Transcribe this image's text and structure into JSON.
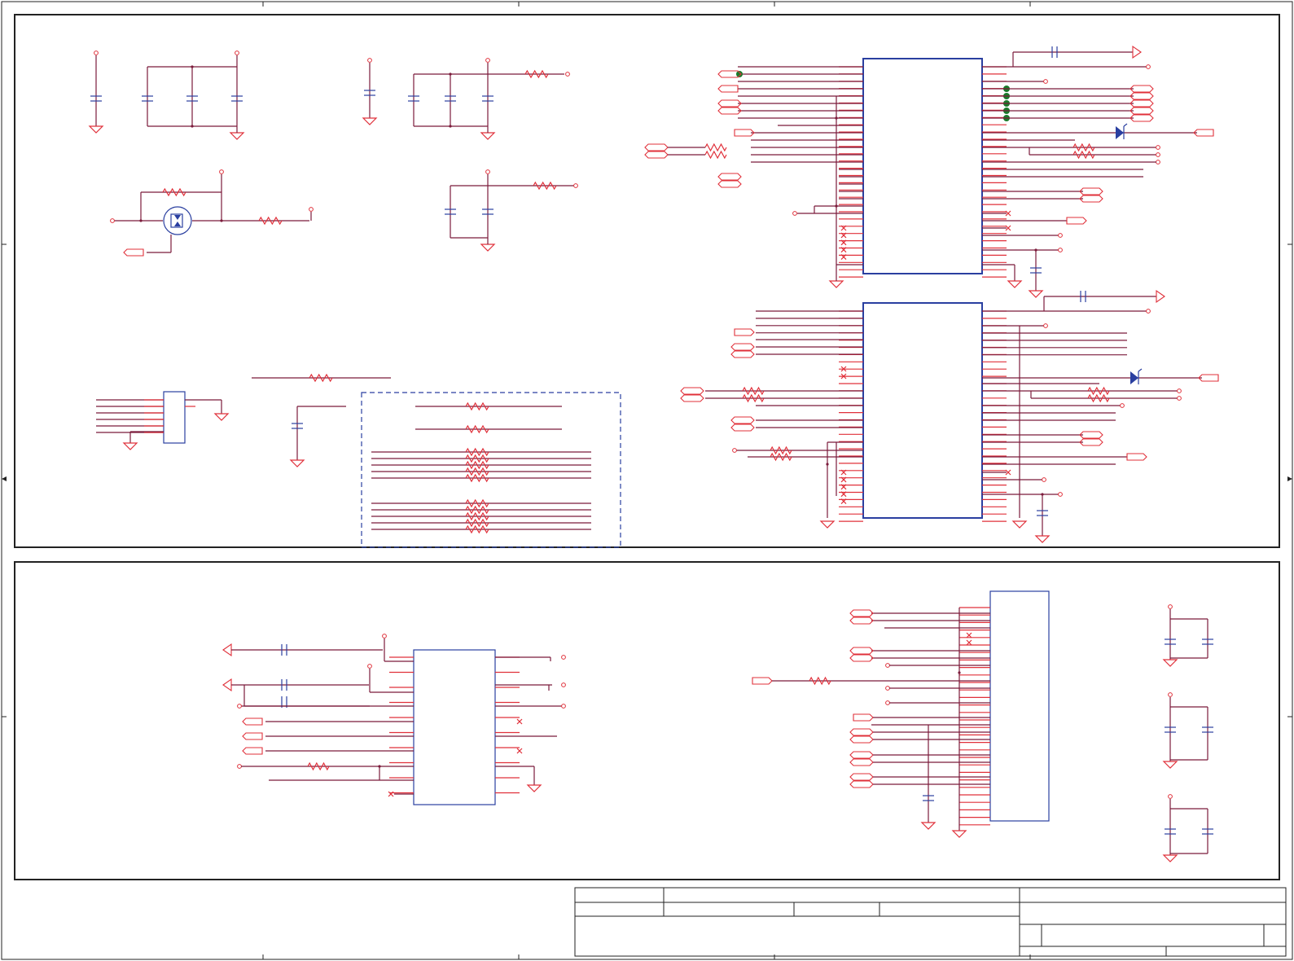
{
  "colors": {
    "wire": "#7b1b3b",
    "pin": "#e0303a",
    "component": "#2a3fa0",
    "frame": "#222222",
    "junction_dot": "#1a7a2a",
    "no_connect": "#e0303a"
  },
  "icons": {
    "resistor": "zigzag-resistor-icon",
    "capacitor": "capacitor-icon",
    "ground": "ground-triangle-icon",
    "port": "net-port-arrow-icon",
    "no_connect": "x-mark-icon",
    "diode": "diode-icon",
    "transistor": "mosfet-icon"
  },
  "sheet": {
    "columns": 5,
    "rows": 4,
    "panels": [
      "top-panel",
      "bottom-panel"
    ],
    "title_block": "empty"
  }
}
